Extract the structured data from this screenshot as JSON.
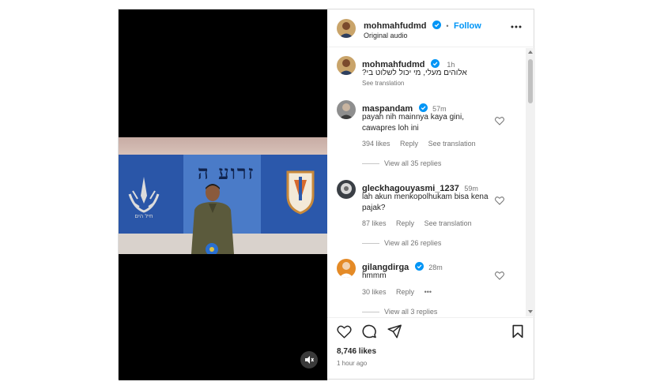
{
  "post": {
    "username": "mohmahfudmd",
    "follow_label": "Follow",
    "separator": "•",
    "audio": "Original audio",
    "more_icon": "more-horizontal-icon"
  },
  "caption": {
    "username": "mohmahfudmd",
    "time": "1h",
    "text": "אלוהים מעלי, מי יכול לשלוט בי?",
    "translate": "See translation"
  },
  "video": {
    "overlay_text": "זרוע ה",
    "mute_icon": "muted-speaker-icon"
  },
  "comments": [
    {
      "username": "maspandam",
      "verified": true,
      "time": "57m",
      "text_line1": "payah nih mainnya kaya gini,",
      "text_line2": "cawapres loh ini",
      "likes": "394 likes",
      "reply": "Reply",
      "translate": "See translation",
      "view_replies": "View all 35 replies"
    },
    {
      "username": "gleckhagouyasmi_1237",
      "verified": false,
      "time": "59m",
      "text_line1": "lah akun menkopolhukam bisa kena",
      "text_line2": "pajak?",
      "likes": "87 likes",
      "reply": "Reply",
      "translate": "See translation",
      "view_replies": "View all 26 replies"
    },
    {
      "username": "gilangdirga",
      "verified": true,
      "time": "28m",
      "text_line1": "hmmm",
      "likes": "30 likes",
      "reply": "Reply",
      "more": "•••",
      "view_replies": "View all 3 replies"
    }
  ],
  "footer": {
    "likes": "8,746 likes",
    "time": "1 hour ago"
  },
  "colors": {
    "accent": "#0095f6",
    "text": "#262626",
    "muted": "#737373"
  }
}
